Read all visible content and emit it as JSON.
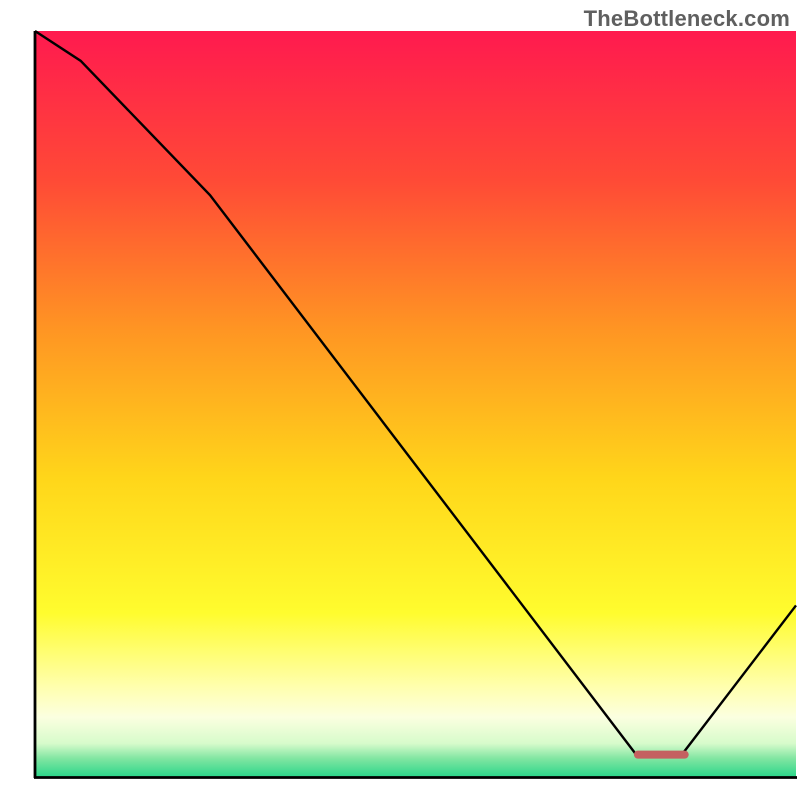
{
  "watermark": "TheBottleneck.com",
  "chart_data": {
    "type": "line",
    "note": "No axis ticks or numeric labels are visible; values below are normalized 0–100 estimates read from the plotted line position relative to the visible plot area. Higher y = closer to top (red), lower y = closer to bottom (green).",
    "title": "",
    "xlabel": "",
    "ylabel": "",
    "xlim": [
      0,
      100
    ],
    "ylim": [
      0,
      100
    ],
    "x": [
      0,
      6,
      23,
      79,
      85,
      100
    ],
    "values": [
      100,
      96,
      78,
      3,
      3,
      23
    ],
    "red_marker": {
      "x_start": 78.7,
      "x_end": 85.9,
      "y": 3.0
    },
    "background_gradient_stops": [
      {
        "pos": 0.0,
        "color": "#ff1a4f"
      },
      {
        "pos": 0.2,
        "color": "#ff4a36"
      },
      {
        "pos": 0.4,
        "color": "#ff9523"
      },
      {
        "pos": 0.6,
        "color": "#ffd61a"
      },
      {
        "pos": 0.78,
        "color": "#fffc2e"
      },
      {
        "pos": 0.88,
        "color": "#ffffaf"
      },
      {
        "pos": 0.92,
        "color": "#fbffe0"
      },
      {
        "pos": 0.955,
        "color": "#d7fbcb"
      },
      {
        "pos": 0.975,
        "color": "#82e6a2"
      },
      {
        "pos": 1.0,
        "color": "#2bd68a"
      }
    ]
  }
}
